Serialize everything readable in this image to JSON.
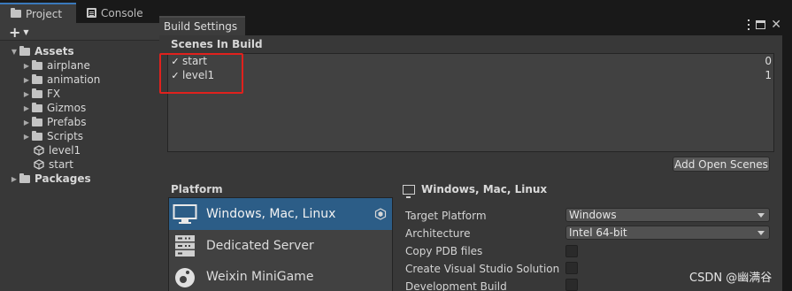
{
  "project_panel": {
    "tabs": [
      {
        "label": "Project",
        "icon": "folder-icon",
        "active": true
      },
      {
        "label": "Console",
        "icon": "console-icon",
        "active": false
      }
    ],
    "add_button": "+",
    "tree": [
      {
        "label": "Assets",
        "type": "folder",
        "expanded": true
      },
      {
        "label": "airplane",
        "type": "folder"
      },
      {
        "label": "animation",
        "type": "folder"
      },
      {
        "label": "FX",
        "type": "folder"
      },
      {
        "label": "Gizmos",
        "type": "folder"
      },
      {
        "label": "Prefabs",
        "type": "folder"
      },
      {
        "label": "Scripts",
        "type": "folder"
      },
      {
        "label": "level1",
        "type": "scene"
      },
      {
        "label": "start",
        "type": "scene"
      },
      {
        "label": "Packages",
        "type": "folder",
        "expanded": false
      }
    ]
  },
  "build_settings": {
    "window_title": "Build Settings",
    "scenes_header": "Scenes In Build",
    "scenes": [
      {
        "name": "start",
        "index": "0",
        "checked": true
      },
      {
        "name": "level1",
        "index": "1",
        "checked": true
      }
    ],
    "add_open_scenes": "Add Open Scenes",
    "platform_header": "Platform",
    "platforms": [
      {
        "label": "Windows, Mac, Linux",
        "icon": "monitor-icon",
        "selected": true
      },
      {
        "label": "Dedicated Server",
        "icon": "server-icon",
        "selected": false
      },
      {
        "label": "Weixin MiniGame",
        "icon": "minigame-icon",
        "selected": false
      }
    ],
    "selected_platform_title": "Windows, Mac, Linux",
    "settings": [
      {
        "label": "Target Platform",
        "value": "Windows",
        "kind": "dropdown"
      },
      {
        "label": "Architecture",
        "value": "Intel 64-bit",
        "kind": "dropdown"
      },
      {
        "label": "Copy PDB files",
        "kind": "toggle"
      },
      {
        "label": "Create Visual Studio Solution",
        "kind": "toggle"
      },
      {
        "label": "Development Build",
        "kind": "toggle"
      }
    ]
  },
  "watermark": "CSDN @幽满谷",
  "colors": {
    "selection": "#2c5d87",
    "highlight_box": "#e0211d",
    "panel_bg": "#383838",
    "dark_bg": "#191919"
  }
}
